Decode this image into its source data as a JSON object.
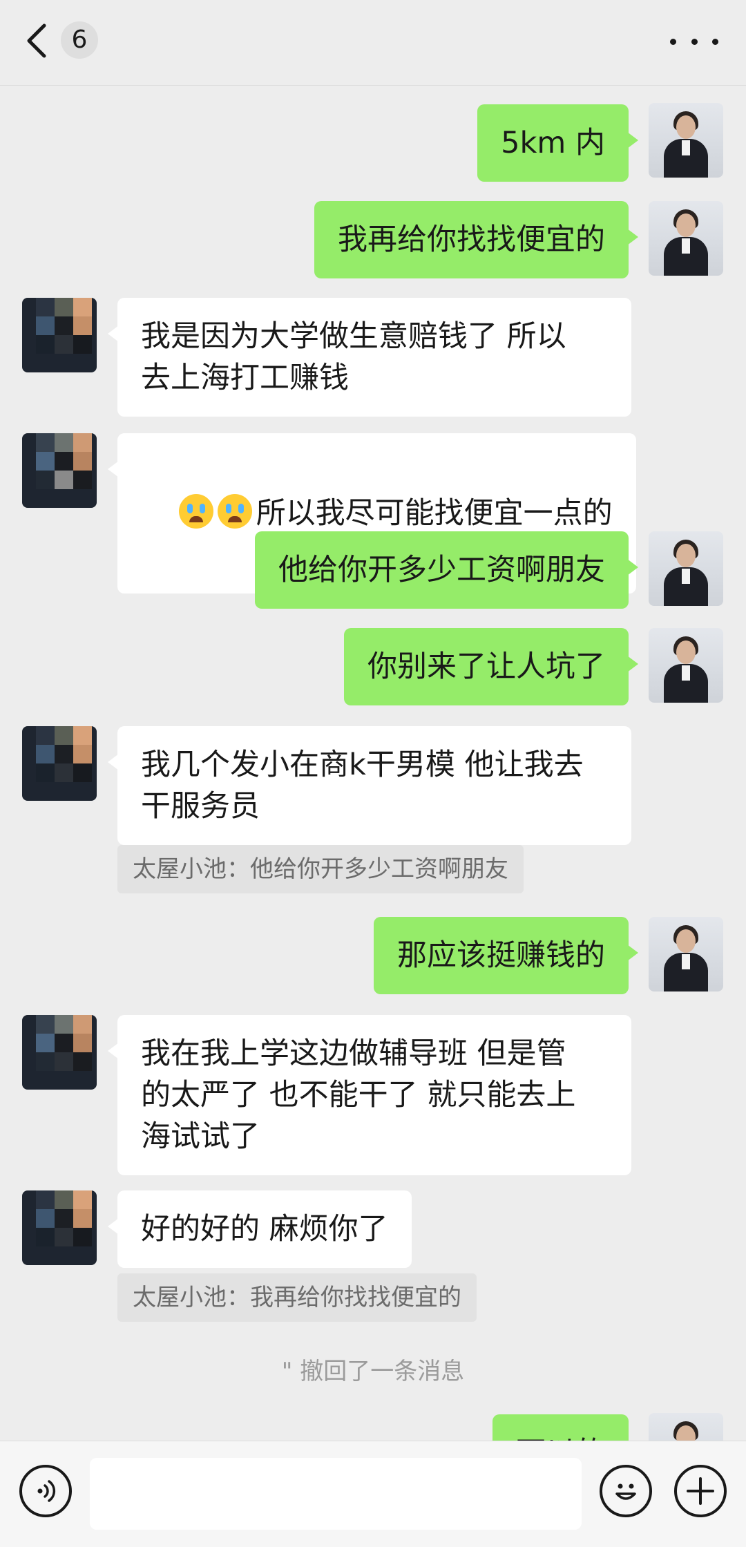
{
  "header": {
    "unread_count": "6"
  },
  "messages": [
    {
      "side": "me",
      "text": "5km 内"
    },
    {
      "side": "me",
      "text": "我再给你找找便宜的"
    },
    {
      "side": "other",
      "text": "我是因为大学做生意赔钱了 所以\n去上海打工赚钱"
    },
    {
      "side": "other",
      "text": "所以我尽可能找便宜一点的",
      "emoji": [
        "crying-face-icon",
        "crying-face-icon"
      ]
    },
    {
      "side": "me",
      "text": "他给你开多少工资啊朋友"
    },
    {
      "side": "me",
      "text": "你别来了让人坑了"
    },
    {
      "side": "other",
      "text": "我几个发小在商k干男模 他让我去\n干服务员",
      "quote": "太屋小池：他给你开多少工资啊朋友"
    },
    {
      "side": "me",
      "text": "那应该挺赚钱的"
    },
    {
      "side": "other",
      "text": "我在我上学这边做辅导班 但是管\n的太严了 也不能干了 就只能去上\n海试试了"
    },
    {
      "side": "other",
      "text": "好的好的 麻烦你了",
      "quote": "太屋小池：我再给你找找便宜的"
    }
  ],
  "system_notice": "\" 撤回了一条消息",
  "partial_message": "可以的",
  "input": {
    "value": ""
  },
  "colors": {
    "my_bubble": "#95ec69",
    "other_bubble": "#ffffff",
    "background": "#ededed"
  }
}
